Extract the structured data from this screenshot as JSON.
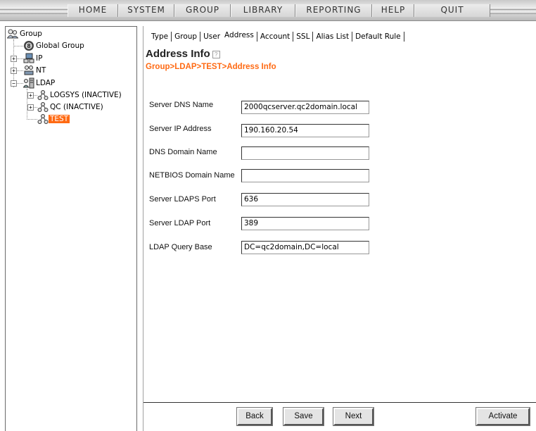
{
  "menubar": {
    "items": [
      {
        "label": "HOME"
      },
      {
        "label": "SYSTEM"
      },
      {
        "label": "GROUP"
      },
      {
        "label": "LIBRARY"
      },
      {
        "label": "REPORTING"
      },
      {
        "label": "HELP"
      },
      {
        "label": "QUIT"
      }
    ]
  },
  "tree": {
    "root": {
      "label": "Group",
      "icon": "users-icon"
    },
    "global_group": {
      "label": "Global Group",
      "icon": "globe-icon"
    },
    "ip": {
      "label": "IP",
      "icon": "network-icon",
      "expander": "+"
    },
    "nt": {
      "label": "NT",
      "icon": "network-group-icon",
      "expander": "+"
    },
    "ldap": {
      "label": "LDAP",
      "icon": "server-icon",
      "expander": "−"
    },
    "logsys": {
      "label": "LOGSYS (INACTIVE)",
      "icon": "ldap-node-icon",
      "expander": "+"
    },
    "qc": {
      "label": "QC (INACTIVE)",
      "icon": "ldap-node-icon",
      "expander": "+"
    },
    "test": {
      "label": "TEST",
      "icon": "ldap-node-icon",
      "selected": true
    }
  },
  "tabs": [
    {
      "label": "Type"
    },
    {
      "label": "Group"
    },
    {
      "label": "User"
    },
    {
      "label": "Address",
      "active": true
    },
    {
      "label": "Account"
    },
    {
      "label": "SSL"
    },
    {
      "label": "Alias List"
    },
    {
      "label": "Default Rule"
    }
  ],
  "page": {
    "title": "Address Info",
    "help_icon": "?",
    "breadcrumb": "Group>LDAP>TEST>Address Info"
  },
  "form": {
    "fields": [
      {
        "label": "Server DNS Name",
        "value": "2000qcserver.qc2domain.local"
      },
      {
        "label": "Server IP Address",
        "value": "190.160.20.54"
      },
      {
        "label": "DNS Domain Name",
        "value": ""
      },
      {
        "label": "NETBIOS Domain Name",
        "value": ""
      },
      {
        "label": "Server LDAPS Port",
        "value": "636"
      },
      {
        "label": "Server LDAP Port",
        "value": "389"
      },
      {
        "label": "LDAP Query Base",
        "value": "DC=qc2domain,DC=local"
      }
    ]
  },
  "buttons": {
    "back": "Back",
    "save": "Save",
    "next": "Next",
    "activate": "Activate"
  },
  "colors": {
    "accent": "#ff6a13",
    "menubar": "#d4d4d4"
  }
}
